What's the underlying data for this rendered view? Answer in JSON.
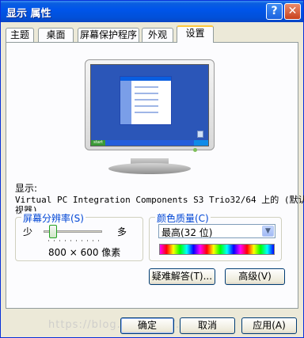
{
  "window": {
    "title": "显示 属性",
    "help_label": "?",
    "close_label": "✕"
  },
  "tabs": [
    {
      "label": "主题"
    },
    {
      "label": "桌面"
    },
    {
      "label": "屏幕保护程序"
    },
    {
      "label": "外观"
    },
    {
      "label": "设置"
    }
  ],
  "active_tab": "设置",
  "monitor_preview": {
    "start_label": "start"
  },
  "display": {
    "label": "显示:",
    "device_line1": "Virtual PC Integration Components S3 Trio32/64 上的 (默认监",
    "device_line2": "视器)"
  },
  "resolution": {
    "legend": "屏幕分辨率(S)",
    "less_label": "少",
    "more_label": "多",
    "value": "800 × 600 像素",
    "slider_position_fraction": 0.1
  },
  "color_quality": {
    "legend": "颜色质量(C)",
    "selected": "最高(32 位)"
  },
  "buttons": {
    "troubleshoot": "疑难解答(T)...",
    "advanced": "高级(V)",
    "ok": "确定",
    "cancel": "取消",
    "apply": "应用(A)"
  },
  "watermark": "https://blog.csdn.net/...",
  "colors": {
    "titlebar": "#0055ea",
    "legend_text": "#0046d5",
    "desktop_preview": "#2b56b8"
  }
}
